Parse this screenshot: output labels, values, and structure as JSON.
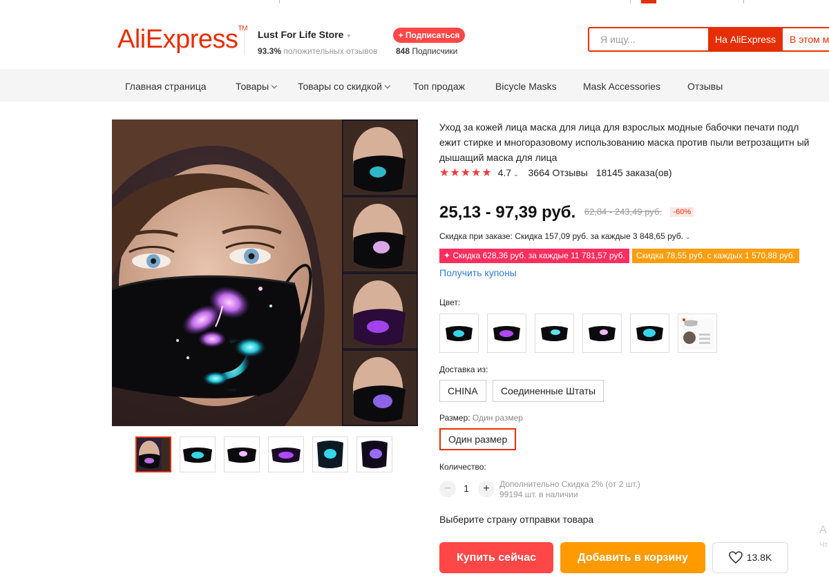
{
  "header": {
    "logo_text": "AliExpress",
    "store_name": "Lust For Life Store",
    "store_positive_value": "93.3%",
    "store_positive_label": "положительных отзывов",
    "subscribe_label": "+ Подписаться",
    "subscribers_count": "848",
    "subscribers_label": "Подписчики",
    "search_placeholder": "Я ищу...",
    "search_aliexpress_label": "На AliExpress",
    "search_store_label": "В этом м"
  },
  "nav": {
    "items": [
      "Главная страница",
      "Товары",
      "Товары со скидкой",
      "Топ продаж",
      "Bicycle Masks",
      "Mask Accessories",
      "Отзывы"
    ]
  },
  "product": {
    "title": "Уход за кожей лица маска для лица для взрослых модные бабочки печати подл ежит стирке и многоразовому использованию маска против пыли ветрозащитн ый дышащий маска для лица",
    "stars": "★★★★★",
    "rating": "4.7",
    "reviews": "3664 Отзывы",
    "orders": "18145 заказа(ов)",
    "price": "25,13 - 97,39 руб.",
    "old_price": "62,84 - 243,49 руб.",
    "discount": "-60%",
    "order_discount": "Скидка при заказе: Скидка 157,09 руб. за каждые 3 848,65 руб.",
    "coupon_red": "✦ Скидка 628,36 руб. за каждые 11 781,57 руб.",
    "coupon_orange": "Скидка 78,55 руб. с каждых 1 570,88 руб.",
    "get_coupons": "Получить купоны",
    "color_label": "Цвет:",
    "ship_from_label": "Доставка из:",
    "ship_from_options": [
      "CHINA",
      "Соединенные Штаты"
    ],
    "size_label": "Размер:",
    "size_selected_hint": "Один размер",
    "size_option": "Один размер",
    "quantity_label": "Количество:",
    "quantity": "1",
    "qty_note_1": "Дополнительно Скидка 2% (от 2 шт.)",
    "qty_note_2": "99194 шт. в наличии",
    "ship_country": "Выберите страну отправки товара",
    "buy_label": "Купить сейчас",
    "cart_label": "Добавить в корзину",
    "wish_count": "13.8K"
  },
  "edge": {
    "letter_1": "A",
    "letter_2": "Чт"
  },
  "colors": {
    "accent": "#e62e04",
    "buy": "#ff4747",
    "cart": "#ff9a00",
    "link": "#2e7bcf"
  }
}
